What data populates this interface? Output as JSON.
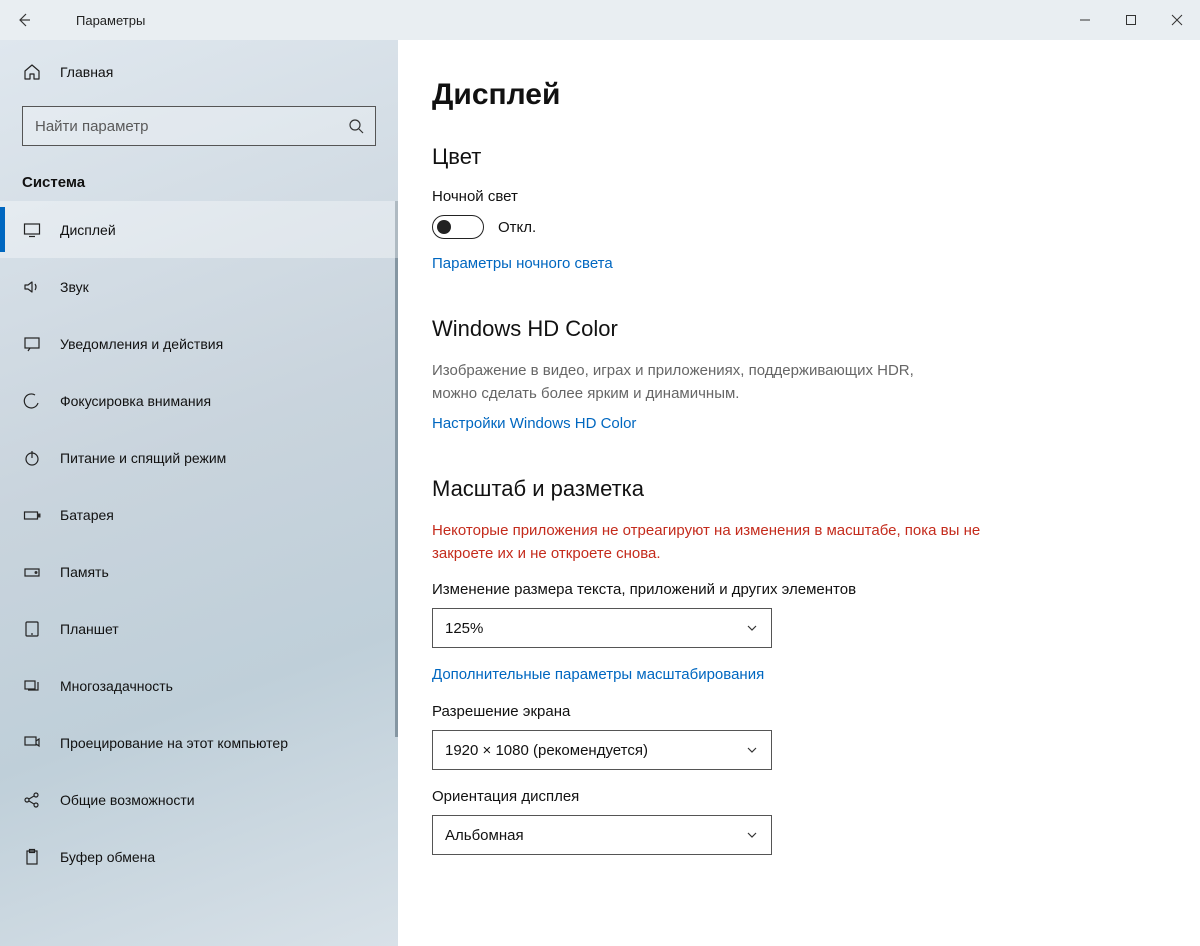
{
  "window": {
    "title": "Параметры"
  },
  "sidebar": {
    "home_label": "Главная",
    "search_placeholder": "Найти параметр",
    "category_label": "Система",
    "items": [
      {
        "icon": "display-icon",
        "label": "Дисплей",
        "selected": true
      },
      {
        "icon": "sound-icon",
        "label": "Звук",
        "selected": false
      },
      {
        "icon": "notifications-icon",
        "label": "Уведомления и действия",
        "selected": false
      },
      {
        "icon": "focus-icon",
        "label": "Фокусировка внимания",
        "selected": false
      },
      {
        "icon": "power-icon",
        "label": "Питание и спящий режим",
        "selected": false
      },
      {
        "icon": "battery-icon",
        "label": "Батарея",
        "selected": false
      },
      {
        "icon": "storage-icon",
        "label": "Память",
        "selected": false
      },
      {
        "icon": "tablet-icon",
        "label": "Планшет",
        "selected": false
      },
      {
        "icon": "multitask-icon",
        "label": "Многозадачность",
        "selected": false
      },
      {
        "icon": "project-icon",
        "label": "Проецирование на этот компьютер",
        "selected": false
      },
      {
        "icon": "shared-icon",
        "label": "Общие возможности",
        "selected": false
      },
      {
        "icon": "clipboard-icon",
        "label": "Буфер обмена",
        "selected": false
      }
    ]
  },
  "main": {
    "page_title": "Дисплей",
    "color": {
      "section_title": "Цвет",
      "night_light_label": "Ночной свет",
      "night_light_state": "Откл.",
      "night_light_link": "Параметры ночного света"
    },
    "hdcolor": {
      "section_title": "Windows HD Color",
      "description": "Изображение в видео, играх и приложениях, поддерживающих HDR, можно сделать более ярким и динамичным.",
      "link": "Настройки Windows HD Color"
    },
    "scale": {
      "section_title": "Масштаб и разметка",
      "warning": "Некоторые приложения не отреагируют на изменения в масштабе, пока вы не закроете их и не откроете снова.",
      "size_label": "Изменение размера текста, приложений и других элементов",
      "size_value": "125%",
      "advanced_link": "Дополнительные параметры масштабирования",
      "resolution_label": "Разрешение экрана",
      "resolution_value": "1920 × 1080 (рекомендуется)",
      "orientation_label": "Ориентация дисплея",
      "orientation_value": "Альбомная"
    }
  }
}
